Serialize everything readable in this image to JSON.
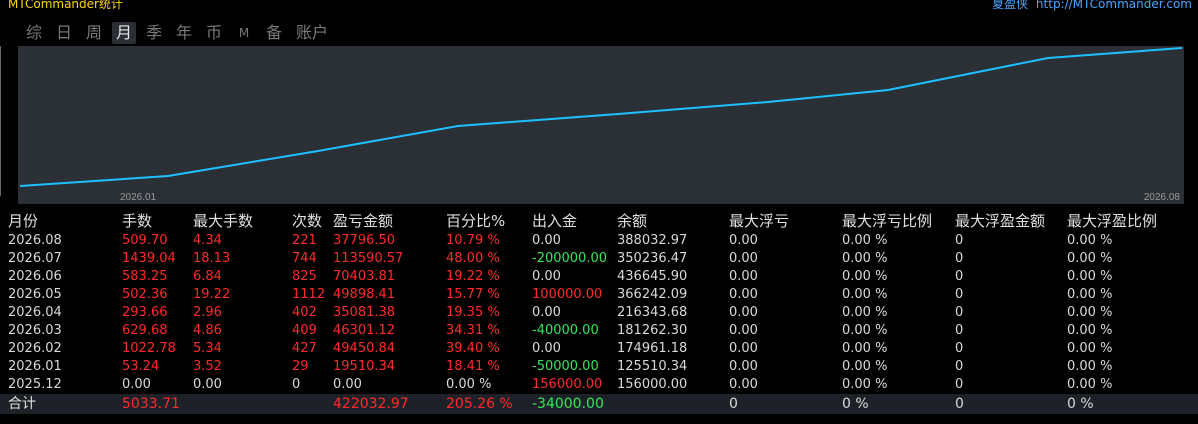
{
  "title": "MTCommander统计",
  "brand": "夏盈侠",
  "url": "http://MTCommander.com",
  "tabs": [
    {
      "label": "综",
      "active": false
    },
    {
      "label": "日",
      "active": false
    },
    {
      "label": "周",
      "active": false
    },
    {
      "label": "月",
      "active": true
    },
    {
      "label": "季",
      "active": false
    },
    {
      "label": "年",
      "active": false
    },
    {
      "label": "币",
      "active": false
    },
    {
      "label": "M",
      "active": false
    },
    {
      "label": "备",
      "active": false
    },
    {
      "label": "账户",
      "active": false
    }
  ],
  "chart_data": {
    "type": "line",
    "x_tick_labels": [
      "2026.01",
      "2026.08"
    ],
    "line_color": "#1ec0ff",
    "background_color": "#2b2f36"
  },
  "table": {
    "headers": [
      "月份",
      "手数",
      "最大手数",
      "次数",
      "盈亏金额",
      "百分比%",
      "出入金",
      "余额",
      "最大浮亏",
      "最大浮亏比例",
      "最大浮盈金额",
      "最大浮盈比例"
    ],
    "rows": [
      [
        "2026.08",
        "509.70",
        "4.34",
        "221",
        "37796.50",
        "10.79 %",
        "0.00",
        "388032.97",
        "0.00",
        "0.00 %",
        "0",
        "0.00 %"
      ],
      [
        "2026.07",
        "1439.04",
        "18.13",
        "744",
        "113590.57",
        "48.00 %",
        "-200000.00",
        "350236.47",
        "0.00",
        "0.00 %",
        "0",
        "0.00 %"
      ],
      [
        "2026.06",
        "583.25",
        "6.84",
        "825",
        "70403.81",
        "19.22 %",
        "0.00",
        "436645.90",
        "0.00",
        "0.00 %",
        "0",
        "0.00 %"
      ],
      [
        "2026.05",
        "502.36",
        "19.22",
        "1112",
        "49898.41",
        "15.77 %",
        "100000.00",
        "366242.09",
        "0.00",
        "0.00 %",
        "0",
        "0.00 %"
      ],
      [
        "2026.04",
        "293.66",
        "2.96",
        "402",
        "35081.38",
        "19.35 %",
        "0.00",
        "216343.68",
        "0.00",
        "0.00 %",
        "0",
        "0.00 %"
      ],
      [
        "2026.03",
        "629.68",
        "4.86",
        "409",
        "46301.12",
        "34.31 %",
        "-40000.00",
        "181262.30",
        "0.00",
        "0.00 %",
        "0",
        "0.00 %"
      ],
      [
        "2026.02",
        "1022.78",
        "5.34",
        "427",
        "49450.84",
        "39.40 %",
        "0.00",
        "174961.18",
        "0.00",
        "0.00 %",
        "0",
        "0.00 %"
      ],
      [
        "2026.01",
        "53.24",
        "3.52",
        "29",
        "19510.34",
        "18.41 %",
        "-50000.00",
        "125510.34",
        "0.00",
        "0.00 %",
        "0",
        "0.00 %"
      ],
      [
        "2025.12",
        "0.00",
        "0.00",
        "0",
        "0.00",
        "0.00 %",
        "156000.00",
        "156000.00",
        "0.00",
        "0.00 %",
        "0",
        "0.00 %"
      ]
    ],
    "total": [
      "合计",
      "5033.71",
      "",
      "",
      "422032.97",
      "205.26 %",
      "-34000.00",
      "",
      "0",
      "0 %",
      "0",
      "0 %"
    ]
  },
  "colors": {
    "positive": "#ff2a2a",
    "inflow": "#ff2a2a",
    "outflow": "#33e65a",
    "neutral": "#d9d9d9"
  }
}
